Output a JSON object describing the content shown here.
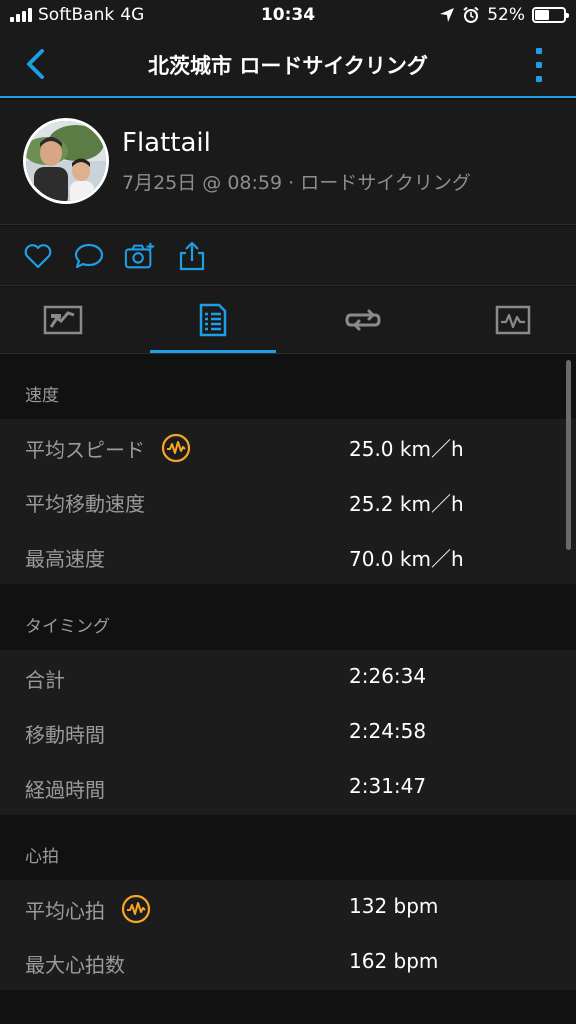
{
  "status_bar": {
    "carrier": "SoftBank",
    "network": "4G",
    "time": "10:34",
    "battery_percent": "52%",
    "battery_level": 0.52
  },
  "nav": {
    "title": "北茨城市 ロードサイクリング",
    "accent_color": "#1e9ee3"
  },
  "profile": {
    "name": "Flattail",
    "meta": "7月25日 @ 08:59 · ロードサイクリング"
  },
  "actions": {
    "icons": [
      "heart-icon",
      "comment-icon",
      "camera-add-icon",
      "share-icon"
    ]
  },
  "tabs": {
    "items": [
      "map-tab",
      "stats-tab",
      "laps-tab",
      "charts-tab"
    ],
    "active_index": 1
  },
  "sections": {
    "speed": {
      "header": "速度",
      "rows": [
        {
          "label": "平均スピード",
          "value": "25.0 km／h",
          "badge": true
        },
        {
          "label": "平均移動速度",
          "value": "25.2 km／h"
        },
        {
          "label": "最高速度",
          "value": "70.0 km／h"
        }
      ]
    },
    "timing": {
      "header": "タイミング",
      "rows": [
        {
          "label": "合計",
          "value": "2:26:34"
        },
        {
          "label": "移動時間",
          "value": "2:24:58"
        },
        {
          "label": "経過時間",
          "value": "2:31:47"
        }
      ]
    },
    "heart": {
      "header": "心拍",
      "rows": [
        {
          "label": "平均心拍",
          "value": "132 bpm",
          "badge": true
        },
        {
          "label": "最大心拍数",
          "value": "162 bpm"
        }
      ]
    }
  },
  "badge_color": "#f5a623"
}
